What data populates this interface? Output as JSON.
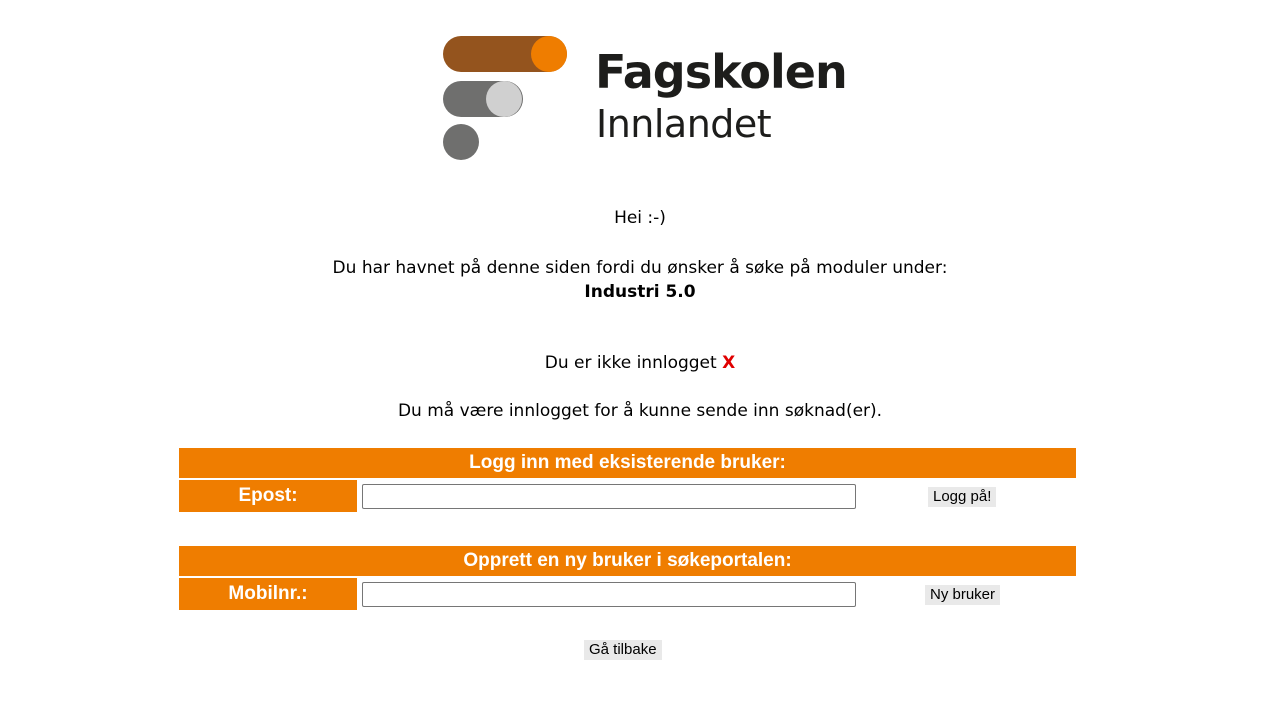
{
  "logo": {
    "title": "Fagskolen",
    "subtitle": "Innlandet",
    "colors": {
      "brown": "#94541e",
      "orange": "#ef7d00",
      "gray": "#6f6f6e",
      "light_gray": "#d0d0d0"
    }
  },
  "greeting": "Hei :-)",
  "intro": "Du har havnet på denne siden fordi du ønsker å søke på moduler under:",
  "program": "Industri 5.0",
  "login_status": {
    "text": "Du er ikke innlogget",
    "mark": "X"
  },
  "login_required": "Du må være innlogget for å kunne sende inn søknad(er).",
  "login_section": {
    "header": "Logg inn med eksisterende bruker:",
    "field_label": "Epost:",
    "field_value": "",
    "button": "Logg på!"
  },
  "register_section": {
    "header": "Opprett en ny bruker i søkeportalen:",
    "field_label": "Mobilnr.:",
    "field_value": "",
    "button": "Ny bruker"
  },
  "back_button": "Gå tilbake",
  "accent_color": "#ef7d00"
}
